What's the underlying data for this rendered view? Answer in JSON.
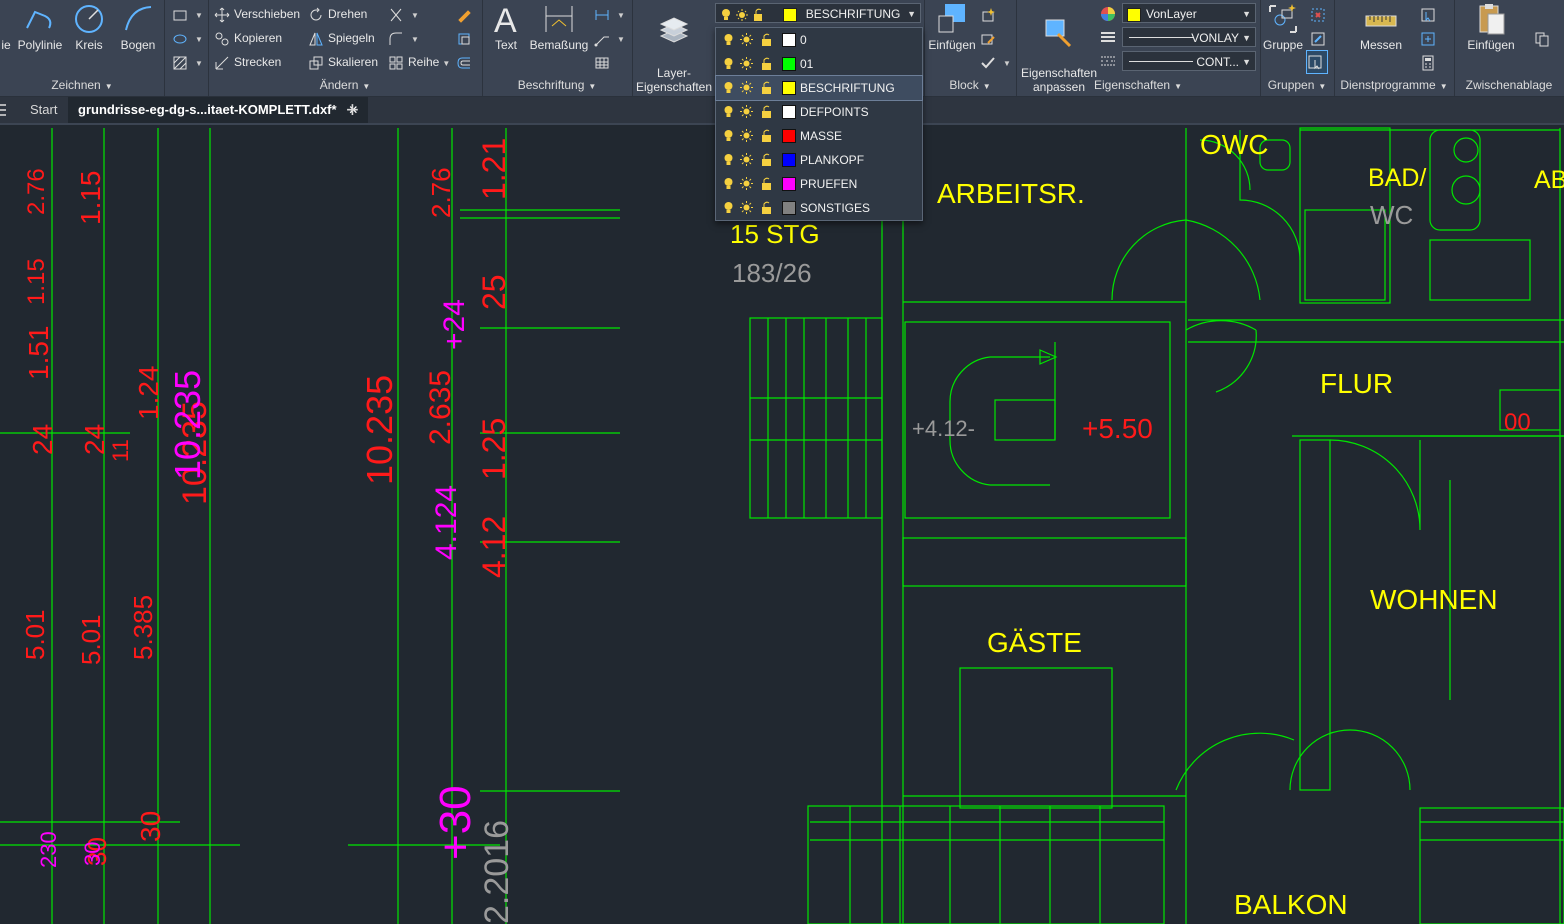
{
  "ribbon": {
    "zeichnen": {
      "title": "Zeichnen",
      "tools": [
        "ie",
        "Polylinie",
        "Kreis",
        "Bogen"
      ]
    },
    "aendern": {
      "title": "Ändern",
      "tools": [
        "Verschieben",
        "Drehen",
        "Kopieren",
        "Spiegeln",
        "Strecken",
        "Skalieren",
        "Reihe"
      ]
    },
    "beschriftung": {
      "title": "Beschriftung",
      "tools": [
        "Text",
        "Bemaßung"
      ]
    },
    "layer": {
      "button_label": "Layer-\nEigenschaften",
      "current": "BESCHRIFTUNG",
      "current_color": "#ffff00"
    },
    "block": {
      "title": "Block",
      "tool": "Einfügen"
    },
    "eigenschaften": {
      "title": "Eigenschaften",
      "match_label": "Eigenschaften\nanpassen",
      "color": "VonLayer",
      "lineweight": "VONLAY",
      "linetype": "CONT..."
    },
    "gruppen": {
      "title": "Gruppen",
      "tool": "Gruppe"
    },
    "dienstprogramme": {
      "title": "Dienstprogramme",
      "tool": "Messen"
    },
    "zwischenablage": {
      "title": "Zwischenablage",
      "tool": "Einfügen"
    }
  },
  "tabs": {
    "start": "Start",
    "file": "grundrisse-eg-dg-s...itaet-KOMPLETT.dxf*",
    "close": "✕",
    "add": "+"
  },
  "layer_dropdown": [
    {
      "name": "0",
      "color": "#ffffff"
    },
    {
      "name": "01",
      "color": "#00ff00"
    },
    {
      "name": "BESCHRIFTUNG",
      "color": "#ffff00",
      "selected": true
    },
    {
      "name": "DEFPOINTS",
      "color": "#ffffff"
    },
    {
      "name": "MASSE",
      "color": "#ff0000"
    },
    {
      "name": "PLANKOPF",
      "color": "#0000ff"
    },
    {
      "name": "PRUEFEN",
      "color": "#ff00ff"
    },
    {
      "name": "SONSTIGES",
      "color": "#808080"
    }
  ],
  "drawing": {
    "rooms": {
      "owc": "OWC",
      "arbeitsr": "ARBEITSR.",
      "bad": "BAD/",
      "wc": "WC",
      "ab": "AB",
      "flur": "FLUR",
      "wohnen": "WOHNEN",
      "gaeste": "GÄSTE",
      "balkon": "BALKON",
      "stg": "15 STG",
      "stg_dim": "183/26"
    },
    "levels": {
      "lvl1": "+4.12-",
      "lvl2": "+5.50",
      "oo": "00"
    },
    "dims_red": [
      "2.76",
      "1.15",
      "1.15",
      "1.51",
      "24",
      "24",
      "11",
      "1.24",
      "10.235",
      "5.01",
      "5.01",
      "5.385",
      "30",
      "30",
      "10.235",
      "2.635",
      "4.12",
      "1.25",
      "2.76",
      "25",
      "1.21"
    ],
    "dims_magenta": [
      "10.235",
      "+24",
      "4.124",
      "+30",
      "230",
      "30"
    ],
    "dim_grey": "2.2016",
    "colors": {
      "green": "#00e600",
      "red": "#ff1a1a",
      "magenta": "#ff00ff",
      "yellow": "#ffff00",
      "grey": "#9a9a9a"
    }
  }
}
